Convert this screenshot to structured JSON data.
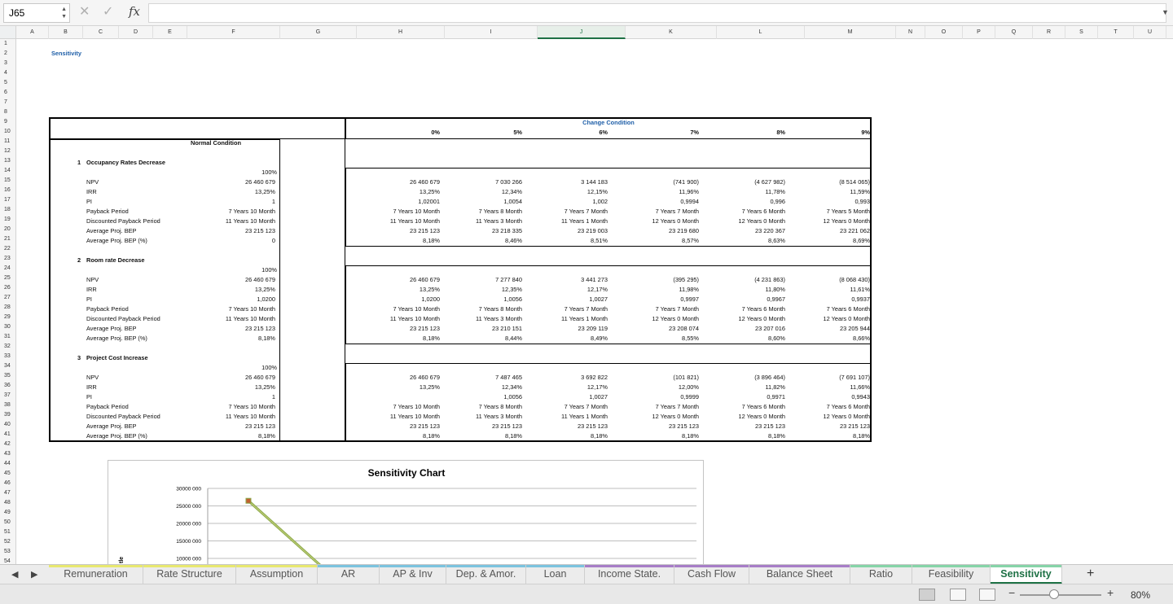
{
  "formula_bar": {
    "name_box": "J65",
    "formula": ""
  },
  "columns": [
    "A",
    "B",
    "C",
    "D",
    "E",
    "F",
    "G",
    "H",
    "I",
    "J",
    "K",
    "L",
    "M",
    "N",
    "O",
    "P",
    "Q",
    "R",
    "S",
    "T",
    "U",
    "V"
  ],
  "selected_column": "J",
  "rows": [
    1,
    2,
    3,
    4,
    5,
    6,
    7,
    8,
    9,
    10,
    11,
    12,
    13,
    14,
    15,
    16,
    17,
    18,
    19,
    20,
    21,
    22,
    23,
    24,
    25,
    26,
    27,
    28,
    29,
    30,
    31,
    32,
    33,
    34,
    35,
    36,
    37,
    38,
    39,
    40,
    41,
    42,
    43,
    44,
    45,
    46,
    47,
    48,
    49,
    50,
    51,
    52,
    53,
    54
  ],
  "sheet": {
    "title": "Sensitivity",
    "change_condition": "Change Condition",
    "percents": [
      "0%",
      "5%",
      "6%",
      "7%",
      "8%",
      "9%"
    ],
    "normal_condition": "Normal Condition",
    "metric_labels": [
      "NPV",
      "IRR",
      "PI",
      "Payback Period",
      "Discounted Payback Period",
      "Average Proj. BEP",
      "Average Proj. BEP (%)"
    ],
    "sections": [
      {
        "number": "1",
        "title": "Occupancy Rates Decrease",
        "normal_pct": "100%",
        "normal": [
          "26 460 679",
          "13,25%",
          "1",
          "7 Years 10 Month",
          "11 Years 10 Month",
          "23 215 123",
          "0"
        ],
        "cols": [
          [
            "26 460 679",
            "13,25%",
            "1,02001",
            "7 Years 10 Month",
            "11 Years 10 Month",
            "23 215 123",
            "8,18%"
          ],
          [
            "7 030 266",
            "12,34%",
            "1,0054",
            "7 Years 8 Month",
            "11 Years 3 Month",
            "23 218 335",
            "8,46%"
          ],
          [
            "3 144 183",
            "12,15%",
            "1,002",
            "7 Years 7 Month",
            "11 Years 1 Month",
            "23 219 003",
            "8,51%"
          ],
          [
            "(741 900)",
            "11,96%",
            "0,9994",
            "7 Years 7 Month",
            "12 Years 0 Month",
            "23 219 680",
            "8,57%"
          ],
          [
            "(4 627 982)",
            "11,78%",
            "0,996",
            "7 Years 6 Month",
            "12 Years 0 Month",
            "23 220 367",
            "8,63%"
          ],
          [
            "(8 514 065)",
            "11,59%",
            "0,993",
            "7 Years 5 Month",
            "12 Years 0 Month",
            "23 221 062",
            "8,69%"
          ]
        ]
      },
      {
        "number": "2",
        "title": "Room rate Decrease",
        "normal_pct": "100%",
        "normal": [
          "26 460 679",
          "13,25%",
          "1,0200",
          "7 Years 10 Month",
          "11 Years 10 Month",
          "23 215 123",
          "8,18%"
        ],
        "cols": [
          [
            "26 460 679",
            "13,25%",
            "1,0200",
            "7 Years 10 Month",
            "11 Years 10 Month",
            "23 215 123",
            "8,18%"
          ],
          [
            "7 277 840",
            "12,35%",
            "1,0056",
            "7 Years 8 Month",
            "11 Years 3 Month",
            "23 210 151",
            "8,44%"
          ],
          [
            "3 441 273",
            "12,17%",
            "1,0027",
            "7 Years 7 Month",
            "11 Years 1 Month",
            "23 209 119",
            "8,49%"
          ],
          [
            "(395 295)",
            "11,98%",
            "0,9997",
            "7 Years 7 Month",
            "12 Years 0 Month",
            "23 208 074",
            "8,55%"
          ],
          [
            "(4 231 863)",
            "11,80%",
            "0,9967",
            "7 Years 6 Month",
            "12 Years 0 Month",
            "23 207 016",
            "8,60%"
          ],
          [
            "(8 068 430)",
            "11,61%",
            "0,9937",
            "7 Years 6 Month",
            "12 Years 0 Month",
            "23 205 944",
            "8,66%"
          ]
        ]
      },
      {
        "number": "3",
        "title": "Project Cost Increase",
        "normal_pct": "100%",
        "normal": [
          "26 460 679",
          "13,25%",
          "1",
          "7 Years 10 Month",
          "11 Years 10 Month",
          "23 215 123",
          "8,18%"
        ],
        "cols": [
          [
            "26 460 679",
            "13,25%",
            "",
            "7 Years 10 Month",
            "11 Years 10 Month",
            "23 215 123",
            "8,18%"
          ],
          [
            "7 487 465",
            "12,34%",
            "1,0056",
            "7 Years 8 Month",
            "11 Years 3 Month",
            "23 215 123",
            "8,18%"
          ],
          [
            "3 692 822",
            "12,17%",
            "1,0027",
            "7 Years 7 Month",
            "11 Years 1 Month",
            "23 215 123",
            "8,18%"
          ],
          [
            "(101 821)",
            "12,00%",
            "0,9999",
            "7 Years 7 Month",
            "12 Years 0 Month",
            "23 215 123",
            "8,18%"
          ],
          [
            "(3 896 464)",
            "11,82%",
            "0,9971",
            "7 Years 6 Month",
            "12 Years 0 Month",
            "23 215 123",
            "8,18%"
          ],
          [
            "(7 691 107)",
            "11,66%",
            "0,9943",
            "7 Years 6 Month",
            "12 Years 0 Month",
            "23 215 123",
            "8,18%"
          ]
        ]
      }
    ]
  },
  "chart_data": {
    "type": "line",
    "title": "Sensitivity Chart",
    "ytick_labels": [
      "30000 000",
      "25000 000",
      "20000 000",
      "15000 000",
      "10000 000"
    ],
    "ylabel_fragment": "tle",
    "ylim": [
      10000000,
      30000000
    ],
    "series": [
      {
        "values": [
          26460679,
          7030266
        ]
      }
    ],
    "colors": [
      "#8aa84a",
      "#c06030"
    ]
  },
  "tabs": [
    "Remuneration",
    "Rate Structure",
    "Assumption",
    "AR",
    "AP & Inv",
    "Dep. & Amor.",
    "Loan",
    "Income State.",
    "Cash Flow",
    "Balance Sheet",
    "Ratio",
    "Feasibility",
    "Sensitivity"
  ],
  "tab_colors": [
    "#e8e870",
    "#e8e870",
    "#e8e870",
    "#7cc3df",
    "#7cc3df",
    "#7cc3df",
    "#7cc3df",
    "#a77dc7",
    "#a77dc7",
    "#a77dc7",
    "#86d4a8",
    "#86d4a8",
    "#86d4a8"
  ],
  "active_tab": "Sensitivity",
  "status": {
    "zoom": "80%"
  }
}
